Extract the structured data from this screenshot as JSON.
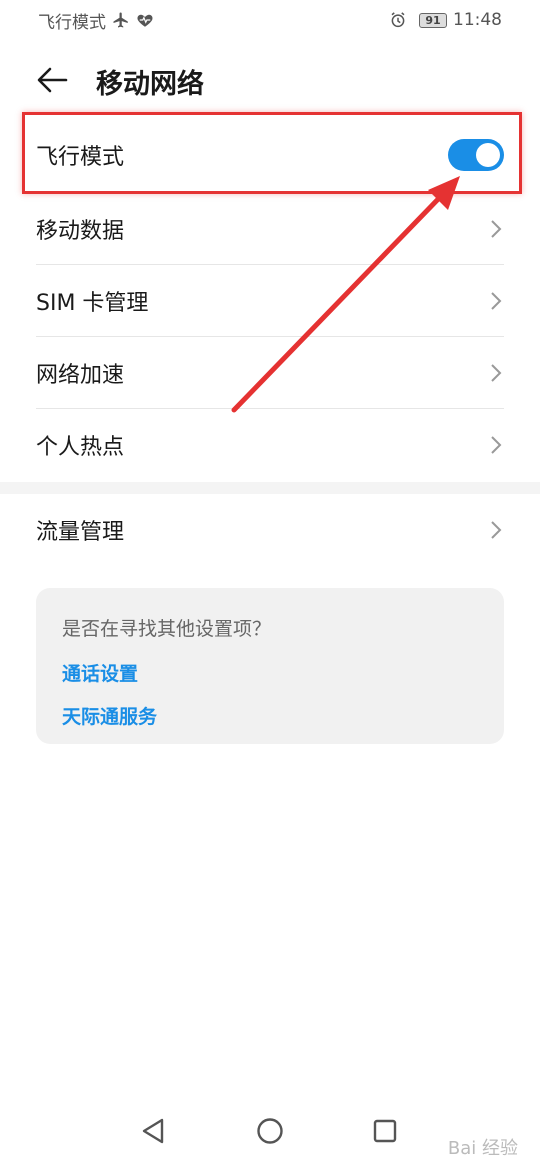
{
  "status_bar": {
    "left_text": "飞行模式",
    "battery_level": "91",
    "time": "11:48"
  },
  "header": {
    "title": "移动网络"
  },
  "list": {
    "airplane_mode": {
      "label": "飞行模式",
      "enabled": true
    },
    "mobile_data": {
      "label": "移动数据"
    },
    "sim_management": {
      "label": "SIM 卡管理"
    },
    "network_acceleration": {
      "label": "网络加速"
    },
    "hotspot": {
      "label": "个人热点"
    },
    "data_usage": {
      "label": "流量管理"
    }
  },
  "suggestion_card": {
    "title": "是否在寻找其他设置项？",
    "links": [
      "通话设置",
      "天际通服务"
    ]
  },
  "watermark": "Bai 经验",
  "colors": {
    "accent": "#1a8ee6",
    "highlight": "#e53232"
  }
}
